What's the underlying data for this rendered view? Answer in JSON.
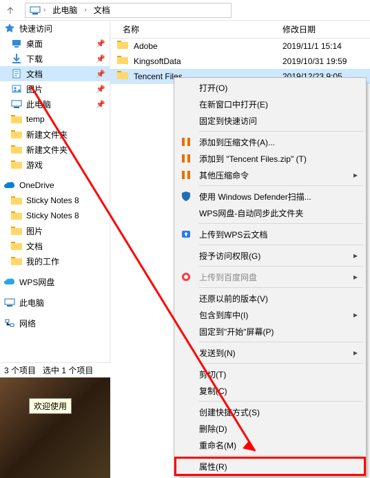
{
  "breadcrumb": {
    "root": "此电脑",
    "current": "文档"
  },
  "nav": {
    "quick_access": "快速访问",
    "sections": [
      {
        "label": "桌面",
        "icon": "desktop",
        "pin": true
      },
      {
        "label": "下载",
        "icon": "download",
        "pin": true
      },
      {
        "label": "文档",
        "icon": "documents",
        "pin": true,
        "selected": true
      },
      {
        "label": "图片",
        "icon": "pictures",
        "pin": true
      },
      {
        "label": "此电脑",
        "icon": "pc",
        "pin": true
      },
      {
        "label": "temp",
        "icon": "folder",
        "pin": false
      },
      {
        "label": "新建文件夹",
        "icon": "folder",
        "pin": false
      },
      {
        "label": "新建文件夹",
        "icon": "folder",
        "pin": false
      },
      {
        "label": "游戏",
        "icon": "folder",
        "pin": false
      }
    ],
    "onedrive": "OneDrive",
    "onedrive_items": [
      {
        "label": "Sticky Notes 8",
        "icon": "folder"
      },
      {
        "label": "Sticky Notes 8",
        "icon": "folder"
      },
      {
        "label": "图片",
        "icon": "folder"
      },
      {
        "label": "文档",
        "icon": "folder"
      },
      {
        "label": "我的工作",
        "icon": "folder"
      }
    ],
    "wps": "WPS网盘",
    "this_pc": "此电脑",
    "network": "网络"
  },
  "columns": {
    "name": "名称",
    "modified": "修改日期"
  },
  "files": [
    {
      "name": "Adobe",
      "date": "2019/11/1 15:14"
    },
    {
      "name": "KingsoftData",
      "date": "2019/10/31 19:59"
    },
    {
      "name": "Tencent Files",
      "date": "2019/12/23 9:05",
      "selected": true
    }
  ],
  "status": {
    "total": "3 个项目",
    "selected": "选中 1 个项目"
  },
  "tooltip": "欢迎使用",
  "menu": {
    "open": "打开(O)",
    "new_window": "在新窗口中打开(E)",
    "pin_quick": "固定到快速访问",
    "sep1": true,
    "add_to_zip": "添加到压缩文件(A)...",
    "add_to_named": "添加到 \"Tencent Files.zip\" (T)",
    "other_zip": "其他压缩命令",
    "sep2": true,
    "defender": "使用 Windows Defender扫描...",
    "wps_sync": "WPS网盘-自动同步此文件夹",
    "sep3": true,
    "wps_cloud": "上传到WPS云文档",
    "sep4": true,
    "grant_access": "授予访问权限(G)",
    "sep5": true,
    "baidu": "上传到百度网盘",
    "sep6": true,
    "restore": "还原以前的版本(V)",
    "include_lib": "包含到库中(I)",
    "pin_start": "固定到\"开始\"屏幕(P)",
    "sep7": true,
    "send_to": "发送到(N)",
    "sep8": true,
    "cut": "剪切(T)",
    "copy": "复制(C)",
    "sep9": true,
    "shortcut": "创建快捷方式(S)",
    "delete": "删除(D)",
    "rename": "重命名(M)",
    "sep10": true,
    "properties": "属性(R)"
  }
}
